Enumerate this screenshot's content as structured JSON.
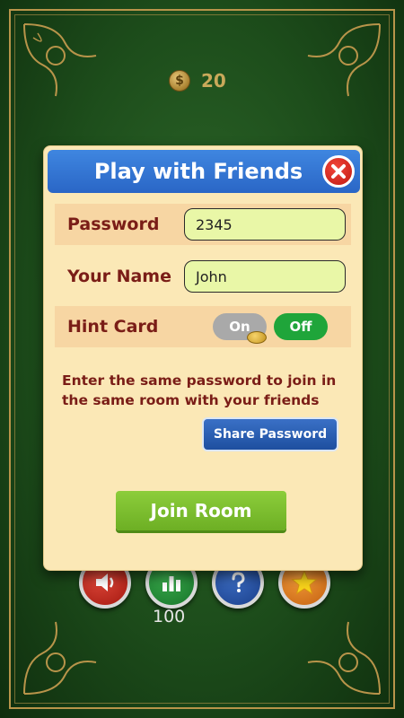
{
  "hud": {
    "coin_symbol": "$",
    "coins": "20"
  },
  "menu": {
    "stats_count": "100"
  },
  "dialog": {
    "title": "Play with Friends",
    "password_label": "Password",
    "password_value": "2345",
    "name_label": "Your Name",
    "name_value": "John",
    "hint_label": "Hint Card",
    "toggle_on": "On",
    "toggle_off": "Off",
    "toggle_state": "Off",
    "instructions": "Enter the same password to join in the same room with your friends",
    "share_button": "Share Password",
    "join_button": "Join Room"
  },
  "colors": {
    "felt_green": "#1d4d1b",
    "header_blue": "#2a66c6",
    "panel_cream": "#fbe8b6",
    "label_maroon": "#7a1d17",
    "join_green": "#7fc02f",
    "toggle_active": "#1fa53a"
  },
  "icons": [
    "close-icon",
    "sound-icon",
    "stats-icon",
    "help-icon",
    "star-icon",
    "coin-icon"
  ]
}
